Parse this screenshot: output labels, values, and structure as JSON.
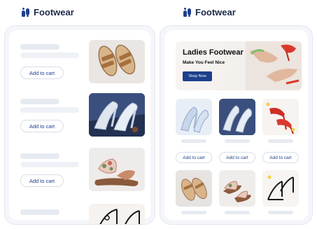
{
  "left_screen": {
    "brand": "Footwear",
    "items": [
      {
        "add_to_cart": "Add to cart",
        "product": "sandal-tan-icon"
      },
      {
        "add_to_cart": "Add to cart",
        "product": "heels-white-lace-icon"
      },
      {
        "add_to_cart": "Add to cart",
        "product": "slide-floral-icon"
      },
      {
        "product": "heels-black-strap-icon"
      }
    ]
  },
  "right_screen": {
    "brand": "Footwear",
    "banner": {
      "title": "Ladies Footwear",
      "subtitle": "Make You Feel Nice",
      "button": "Shop Now"
    },
    "grid_row1": [
      {
        "add_to_cart": "Add to cart",
        "product": "heels-blue-icon"
      },
      {
        "add_to_cart": "Add to cart",
        "product": "heels-white-lace-icon"
      },
      {
        "add_to_cart": "Add to cart",
        "product": "heels-red-icon"
      }
    ],
    "grid_row2": [
      {
        "product": "sandal-tan-icon"
      },
      {
        "product": "slide-brown-icon"
      },
      {
        "product": "heels-black-strap-icon"
      }
    ]
  },
  "colors": {
    "brand_navy": "#1d3f8c",
    "skeleton": "#e6eaf1",
    "device_bg": "#f4f6fa"
  }
}
